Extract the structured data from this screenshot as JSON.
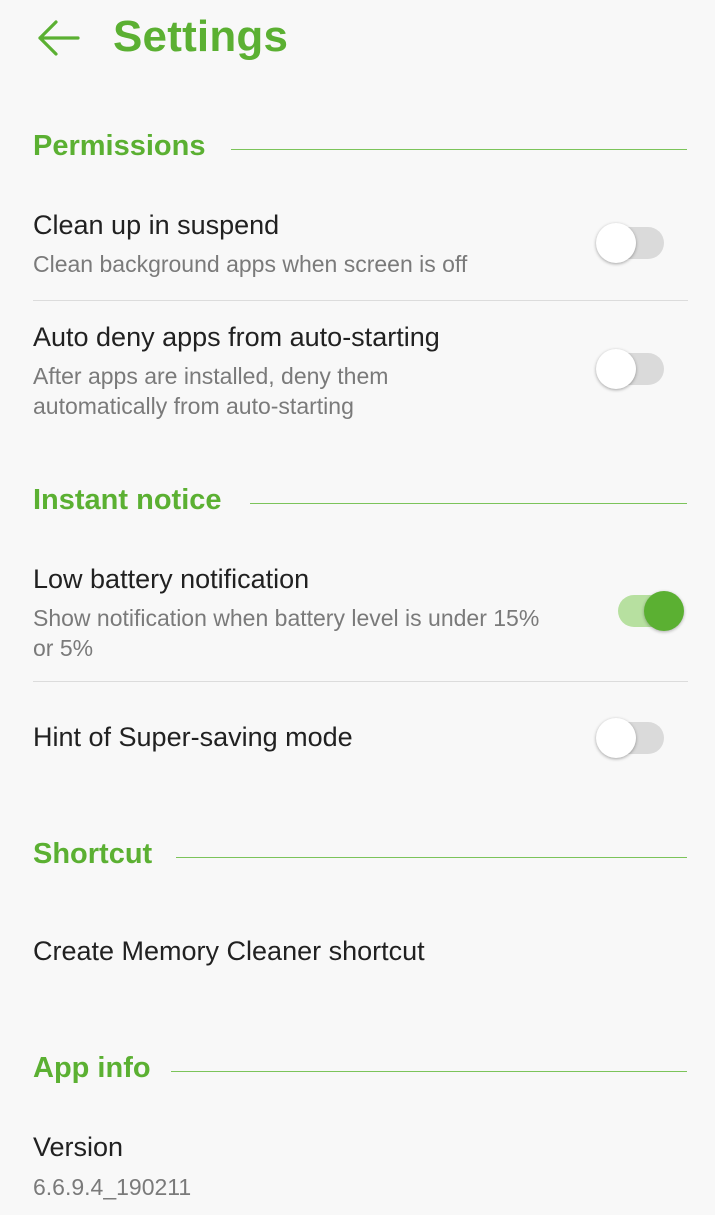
{
  "header": {
    "title": "Settings"
  },
  "sections": {
    "permissions": {
      "title": "Permissions"
    },
    "instant_notice": {
      "title": "Instant notice"
    },
    "shortcut": {
      "title": "Shortcut"
    },
    "app_info": {
      "title": "App info"
    }
  },
  "settings": {
    "clean_up": {
      "title": "Clean up in suspend",
      "subtitle": "Clean background apps when screen is off",
      "enabled": false
    },
    "auto_deny": {
      "title": "Auto deny apps from auto-starting",
      "subtitle": "After apps are installed, deny them automatically from auto-starting",
      "enabled": false
    },
    "low_battery": {
      "title": "Low battery notification",
      "subtitle": "Show notification when battery level is under 15% or 5%",
      "enabled": true
    },
    "super_saving": {
      "title": "Hint of Super-saving mode",
      "enabled": false
    },
    "create_shortcut": {
      "title": "Create Memory Cleaner shortcut"
    },
    "version": {
      "title": "Version",
      "value": "6.6.9.4_190211"
    }
  },
  "colors": {
    "accent": "#5bb032",
    "accent_light": "#b7e0a0",
    "track_off": "#dadada"
  },
  "icons": {
    "back": "arrow-left-icon"
  }
}
